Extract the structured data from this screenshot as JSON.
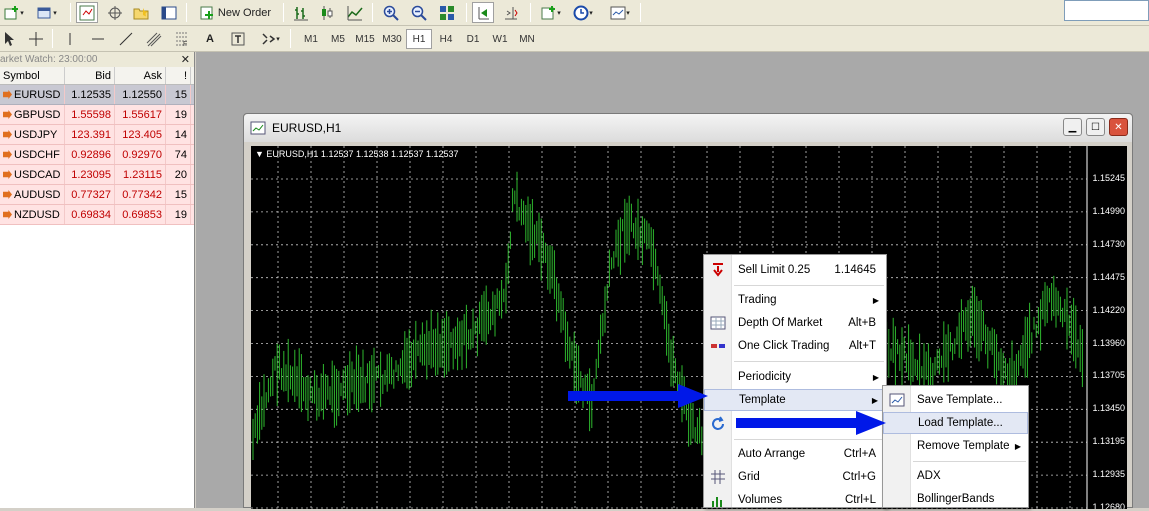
{
  "toolbar": {
    "new_order_label": "New Order",
    "periods": [
      "M1",
      "M5",
      "M15",
      "M30",
      "H1",
      "H4",
      "D1",
      "W1",
      "MN"
    ],
    "active_period": "H1",
    "drawing_text_tool": "A"
  },
  "market_watch": {
    "title": "arket Watch: 23:00:00",
    "columns": [
      "Symbol",
      "Bid",
      "Ask",
      "!"
    ],
    "rows": [
      {
        "symbol": "EURUSD",
        "bid": "1.12535",
        "ask": "1.12550",
        "spread": "15"
      },
      {
        "symbol": "GBPUSD",
        "bid": "1.55598",
        "ask": "1.55617",
        "spread": "19"
      },
      {
        "symbol": "USDJPY",
        "bid": "123.391",
        "ask": "123.405",
        "spread": "14"
      },
      {
        "symbol": "USDCHF",
        "bid": "0.92896",
        "ask": "0.92970",
        "spread": "74"
      },
      {
        "symbol": "USDCAD",
        "bid": "1.23095",
        "ask": "1.23115",
        "spread": "20"
      },
      {
        "symbol": "AUDUSD",
        "bid": "0.77327",
        "ask": "0.77342",
        "spread": "15"
      },
      {
        "symbol": "NZDUSD",
        "bid": "0.69834",
        "ask": "0.69853",
        "spread": "19"
      }
    ]
  },
  "chart_window": {
    "title": "EURUSD,H1",
    "info_line": "EURUSD,H1  1.12537 1.12538 1.12537 1.12537",
    "price_ticks": [
      "1.15245",
      "1.14990",
      "1.14730",
      "1.14475",
      "1.14220",
      "1.13960",
      "1.13705",
      "1.13450",
      "1.13195",
      "1.12935",
      "1.12680"
    ]
  },
  "context_menu": {
    "sell_limit_label": "Sell Limit 0.25",
    "sell_limit_price": "1.14645",
    "trading": "Trading",
    "depth_of_market": "Depth Of Market",
    "depth_of_market_key": "Alt+B",
    "one_click_trading": "One Click Trading",
    "one_click_trading_key": "Alt+T",
    "periodicity": "Periodicity",
    "template": "Template",
    "auto_arrange": "Auto Arrange",
    "auto_arrange_key": "Ctrl+A",
    "grid": "Grid",
    "grid_key": "Ctrl+G",
    "volumes": "Volumes",
    "volumes_key": "Ctrl+L"
  },
  "template_submenu": {
    "save_template": "Save Template...",
    "load_template": "Load Template...",
    "remove_template": "Remove Template",
    "adx": "ADX",
    "bollinger_bands": "BollingerBands"
  },
  "colors": {
    "chart_bg": "#000000",
    "candle": "#2eb82e",
    "annotation_arrow": "#0018e8",
    "quote_row_bg": "#ffe3e3"
  }
}
